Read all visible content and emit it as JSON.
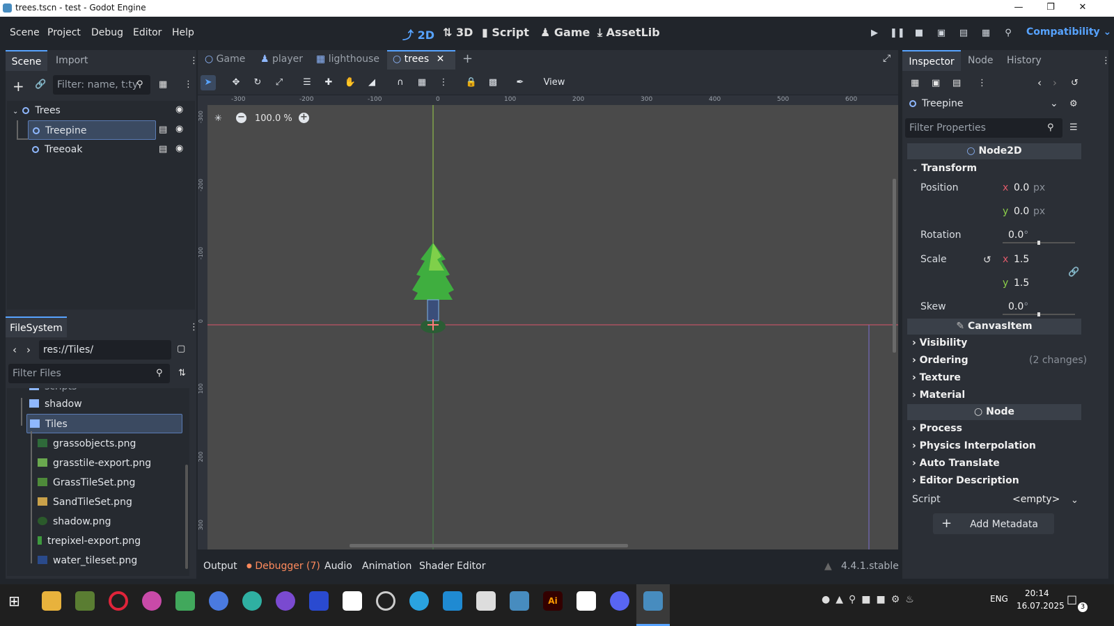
{
  "window": {
    "title": "trees.tscn - test - Godot Engine",
    "minimize_icon": "minimize-icon",
    "maximize_icon": "restore-icon",
    "close_icon": "close-icon"
  },
  "menu": {
    "items": [
      "Scene",
      "Project",
      "Debug",
      "Editor",
      "Help"
    ]
  },
  "workspaces": [
    {
      "label": "2D",
      "icon": "2d-icon",
      "active": true
    },
    {
      "label": "3D",
      "icon": "3d-icon",
      "active": false
    },
    {
      "label": "Script",
      "icon": "script-icon",
      "active": false
    },
    {
      "label": "Game",
      "icon": "game-icon",
      "active": false
    },
    {
      "label": "AssetLib",
      "icon": "assetlib-icon",
      "active": false
    }
  ],
  "renderer": "Compatibility",
  "scene_panel": {
    "tabs": [
      "Scene",
      "Import"
    ],
    "filter_placeholder": "Filter: name, t:ty",
    "nodes": [
      {
        "label": "Trees",
        "depth": 0
      },
      {
        "label": "Treepine",
        "depth": 1,
        "selected": true
      },
      {
        "label": "Treeoak",
        "depth": 1
      }
    ]
  },
  "filesystem": {
    "title": "FileSystem",
    "path": "res://Tiles/",
    "filter_placeholder": "Filter Files",
    "partial_top": "scripts",
    "folders": [
      "shadow",
      "Tiles"
    ],
    "files": [
      "grassobjects.png",
      "grasstile-export.png",
      "GrassTileSet.png",
      "SandTileSet.png",
      "shadow.png",
      "trepixel-export.png",
      "water_tileset.png"
    ]
  },
  "editor_tabs": [
    {
      "label": "Game",
      "active": false
    },
    {
      "label": "player",
      "active": false
    },
    {
      "label": "lighthouse",
      "active": false
    },
    {
      "label": "trees",
      "active": true
    }
  ],
  "toolbar": {
    "view_label": "View"
  },
  "viewport": {
    "zoom": "100.0 %",
    "ruler_top": [
      "-300",
      "-200",
      "-100",
      "0",
      "100",
      "200",
      "300",
      "400",
      "500",
      "600"
    ],
    "ruler_left": [
      "-300",
      "-200",
      "-100",
      "0",
      "100",
      "200",
      "300"
    ]
  },
  "bottom_bar": {
    "tabs": [
      "Output",
      "Debugger (7)",
      "Audio",
      "Animation",
      "Shader Editor"
    ],
    "version": "4.4.1.stable"
  },
  "inspector": {
    "tabs": [
      "Inspector",
      "Node",
      "History"
    ],
    "node_name": "Treepine",
    "filter_placeholder": "Filter Properties",
    "section_node2d": "Node2D",
    "group_transform": "Transform",
    "position_label": "Position",
    "position_x": "0.0",
    "position_y": "0.0",
    "unit_px": "px",
    "rotation_label": "Rotation",
    "rotation": "0.0",
    "degree": "°",
    "scale_label": "Scale",
    "scale_x": "1.5",
    "scale_y": "1.5",
    "skew_label": "Skew",
    "skew": "0.0",
    "axis_x": "x",
    "axis_y": "y",
    "section_canvasitem": "CanvasItem",
    "groups_canvas": [
      "Visibility",
      "Ordering",
      "Texture",
      "Material"
    ],
    "ordering_note": "(2 changes)",
    "section_node": "Node",
    "groups_node": [
      "Process",
      "Physics Interpolation",
      "Auto Translate",
      "Editor Description"
    ],
    "script_label": "Script",
    "script_value": "<empty>",
    "add_metadata": "Add Metadata"
  },
  "taskbar": {
    "apps": [
      "start-icon",
      "explorer-icon",
      "minecraft-icon",
      "opera-icon",
      "paint-icon",
      "qt-icon",
      "firefox-icon",
      "app-icon",
      "viber-icon",
      "origin-icon",
      "capcut-icon",
      "obs-icon",
      "telegram-icon",
      "vscode-icon",
      "unity-icon",
      "godot-icon",
      "illustrator-icon",
      "twitch-icon",
      "discord-icon",
      "godot-active-icon"
    ],
    "language": "ENG",
    "time": "20:14",
    "date": "16.07.2025",
    "notifications": "3"
  },
  "colors": {
    "accent": "#57a3ff",
    "bg": "#21252b",
    "panel": "#2b2f36",
    "viewport": "#4a4a4a",
    "debugger": "#ff8a5c"
  }
}
